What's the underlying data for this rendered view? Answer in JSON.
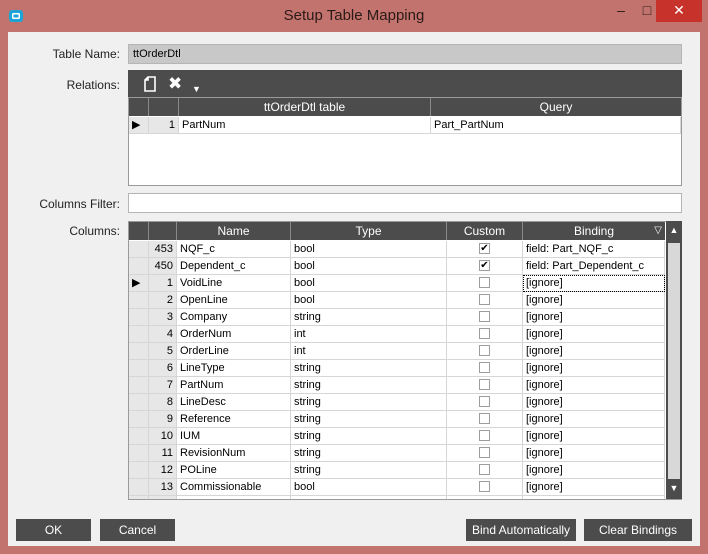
{
  "window": {
    "title": "Setup Table Mapping"
  },
  "labels": {
    "table_name": "Table Name:",
    "relations": "Relations:",
    "columns_filter": "Columns Filter:",
    "columns": "Columns:"
  },
  "table_name_value": "ttOrderDtl",
  "columns_filter_value": "",
  "relations": {
    "headers": [
      "ttOrderDtl table",
      "Query"
    ],
    "rows": [
      {
        "num": "1",
        "table": "PartNum",
        "query": "Part_PartNum"
      }
    ]
  },
  "columns_grid": {
    "headers": [
      "Name",
      "Type",
      "Custom",
      "Binding"
    ],
    "rows": [
      {
        "num": "453",
        "name": "NQF_c",
        "type": "bool",
        "custom": "checked",
        "binding": "field: Part_NQF_c"
      },
      {
        "num": "450",
        "name": "Dependent_c",
        "type": "bool",
        "custom": "checked",
        "binding": "field: Part_Dependent_c"
      },
      {
        "num": "1",
        "name": "VoidLine",
        "type": "bool",
        "custom": "",
        "binding": "[ignore]"
      },
      {
        "num": "2",
        "name": "OpenLine",
        "type": "bool",
        "custom": "",
        "binding": "[ignore]"
      },
      {
        "num": "3",
        "name": "Company",
        "type": "string",
        "custom": "",
        "binding": "[ignore]"
      },
      {
        "num": "4",
        "name": "OrderNum",
        "type": "int",
        "custom": "",
        "binding": "[ignore]"
      },
      {
        "num": "5",
        "name": "OrderLine",
        "type": "int",
        "custom": "",
        "binding": "[ignore]"
      },
      {
        "num": "6",
        "name": "LineType",
        "type": "string",
        "custom": "",
        "binding": "[ignore]"
      },
      {
        "num": "7",
        "name": "PartNum",
        "type": "string",
        "custom": "",
        "binding": "[ignore]"
      },
      {
        "num": "8",
        "name": "LineDesc",
        "type": "string",
        "custom": "",
        "binding": "[ignore]"
      },
      {
        "num": "9",
        "name": "Reference",
        "type": "string",
        "custom": "",
        "binding": "[ignore]"
      },
      {
        "num": "10",
        "name": "IUM",
        "type": "string",
        "custom": "",
        "binding": "[ignore]"
      },
      {
        "num": "11",
        "name": "RevisionNum",
        "type": "string",
        "custom": "",
        "binding": "[ignore]"
      },
      {
        "num": "12",
        "name": "POLine",
        "type": "string",
        "custom": "",
        "binding": "[ignore]"
      },
      {
        "num": "13",
        "name": "Commissionable",
        "type": "bool",
        "custom": "",
        "binding": "[ignore]"
      }
    ]
  },
  "buttons": {
    "ok": "OK",
    "cancel": "Cancel",
    "bind_automatically": "Bind Automatically",
    "clear_bindings": "Clear Bindings"
  },
  "colors": {
    "titlebar": "#c2736d",
    "close_button": "#c7332a",
    "dark_header": "#4c4c4c"
  }
}
